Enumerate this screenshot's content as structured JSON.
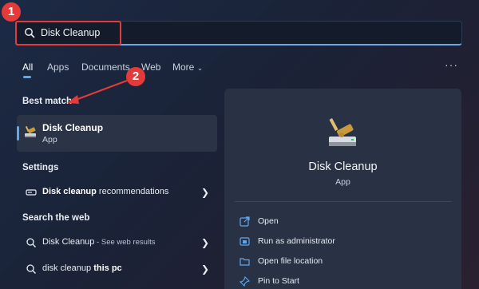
{
  "search": {
    "value": "Disk Cleanup"
  },
  "callouts": [
    "1",
    "2"
  ],
  "tabs": [
    "All",
    "Apps",
    "Documents",
    "Web",
    "More"
  ],
  "more_menu": "···",
  "sections": {
    "best_match": "Best match",
    "settings": "Settings",
    "search_web": "Search the web"
  },
  "best_match": {
    "title": "Disk Cleanup",
    "subtitle": "App"
  },
  "settings_item": {
    "bold": "Disk cleanup",
    "rest": " recommendations"
  },
  "web_items": [
    {
      "bold": "Disk Cleanup",
      "hint": " - See web results"
    },
    {
      "bold": "disk cleanup",
      "rest": " this pc"
    }
  ],
  "panel": {
    "title": "Disk Cleanup",
    "subtitle": "App",
    "actions": [
      "Open",
      "Run as administrator",
      "Open file location",
      "Pin to Start"
    ]
  },
  "colors": {
    "accent": "#5fa8f0",
    "callout": "#e53a3a"
  }
}
